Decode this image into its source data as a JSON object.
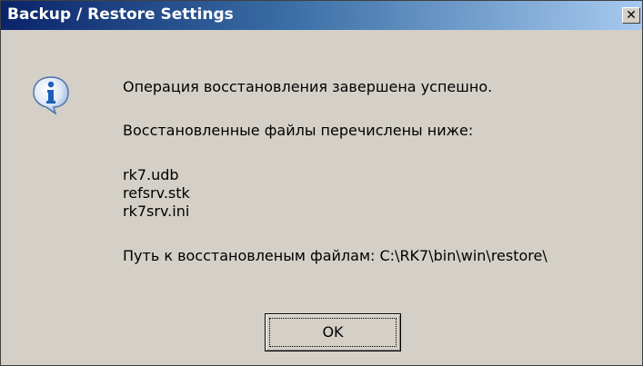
{
  "window": {
    "title": "Backup / Restore Settings",
    "close_glyph": "✕"
  },
  "dialog": {
    "icon": "info-icon",
    "message_line1": "Операция восстановления завершена успешно.",
    "message_line2": "Восстановленные файлы перечислены ниже:",
    "files": [
      "rk7.udb",
      "refsrv.stk",
      "rk7srv.ini"
    ],
    "path_line": "Путь к восстановленым файлам: C:\\RK7\\bin\\win\\restore\\"
  },
  "buttons": {
    "ok_label": "OK"
  },
  "colors": {
    "face": "#d4d0c8",
    "title_start": "#0a246a",
    "title_end": "#a6caf0",
    "icon_blue": "#1c5fb8"
  }
}
